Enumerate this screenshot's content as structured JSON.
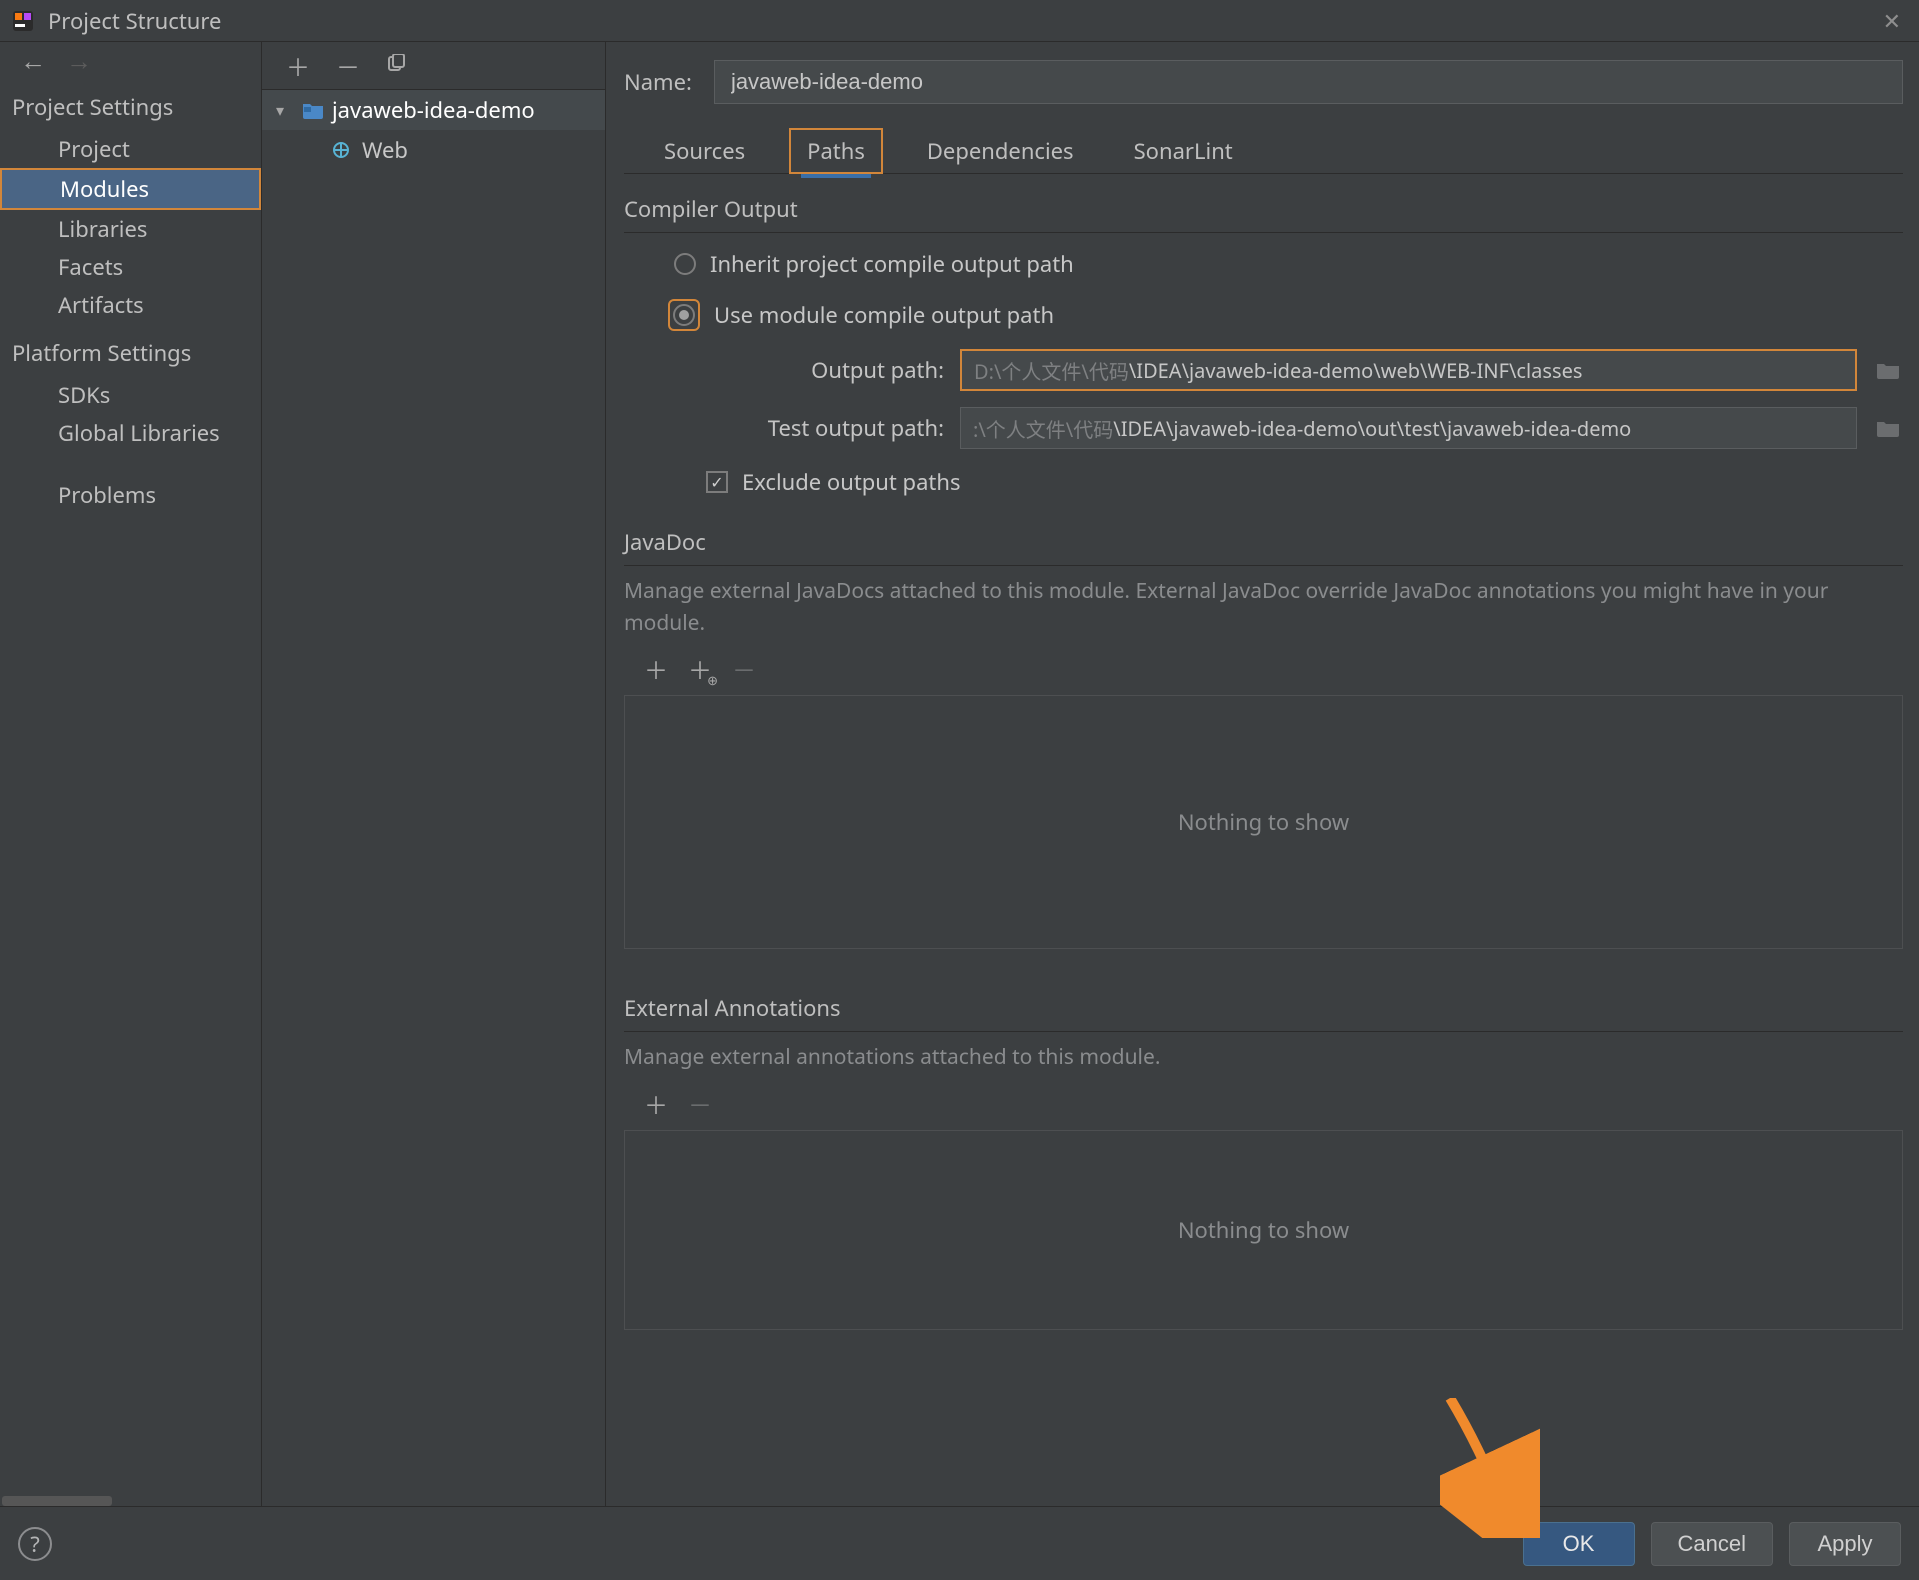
{
  "window": {
    "title": "Project Structure"
  },
  "left_nav": {
    "section_project": "Project Settings",
    "section_platform": "Platform Settings",
    "items_project": [
      {
        "label": "Project"
      },
      {
        "label": "Modules",
        "selected": true
      },
      {
        "label": "Libraries"
      },
      {
        "label": "Facets"
      },
      {
        "label": "Artifacts"
      }
    ],
    "items_platform": [
      {
        "label": "SDKs"
      },
      {
        "label": "Global Libraries"
      }
    ],
    "problems": "Problems"
  },
  "tree": {
    "module_name": "javaweb-idea-demo",
    "facet_name": "Web"
  },
  "main": {
    "name_label": "Name:",
    "name_value": "javaweb-idea-demo",
    "tabs": {
      "sources": "Sources",
      "paths": "Paths",
      "dependencies": "Dependencies",
      "sonarlint": "SonarLint"
    },
    "compiler": {
      "header": "Compiler Output",
      "inherit": "Inherit project compile output path",
      "use_module": "Use module compile output path",
      "output_label": "Output path:",
      "output_gray": "D:\\个人文件\\代码",
      "output_light": "\\IDEA\\javaweb-idea-demo\\web\\WEB-INF\\classes",
      "test_label": "Test output path:",
      "test_gray": ":\\个人文件\\代码",
      "test_light": "\\IDEA\\javaweb-idea-demo\\out\\test\\javaweb-idea-demo",
      "exclude": "Exclude output paths"
    },
    "javadoc": {
      "header": "JavaDoc",
      "hint": "Manage external JavaDocs attached to this module. External JavaDoc override JavaDoc annotations you might have in your module.",
      "empty": "Nothing to show"
    },
    "ext_anno": {
      "header": "External Annotations",
      "hint": "Manage external annotations attached to this module.",
      "empty": "Nothing to show"
    }
  },
  "footer": {
    "ok": "OK",
    "cancel": "Cancel",
    "apply": "Apply"
  }
}
